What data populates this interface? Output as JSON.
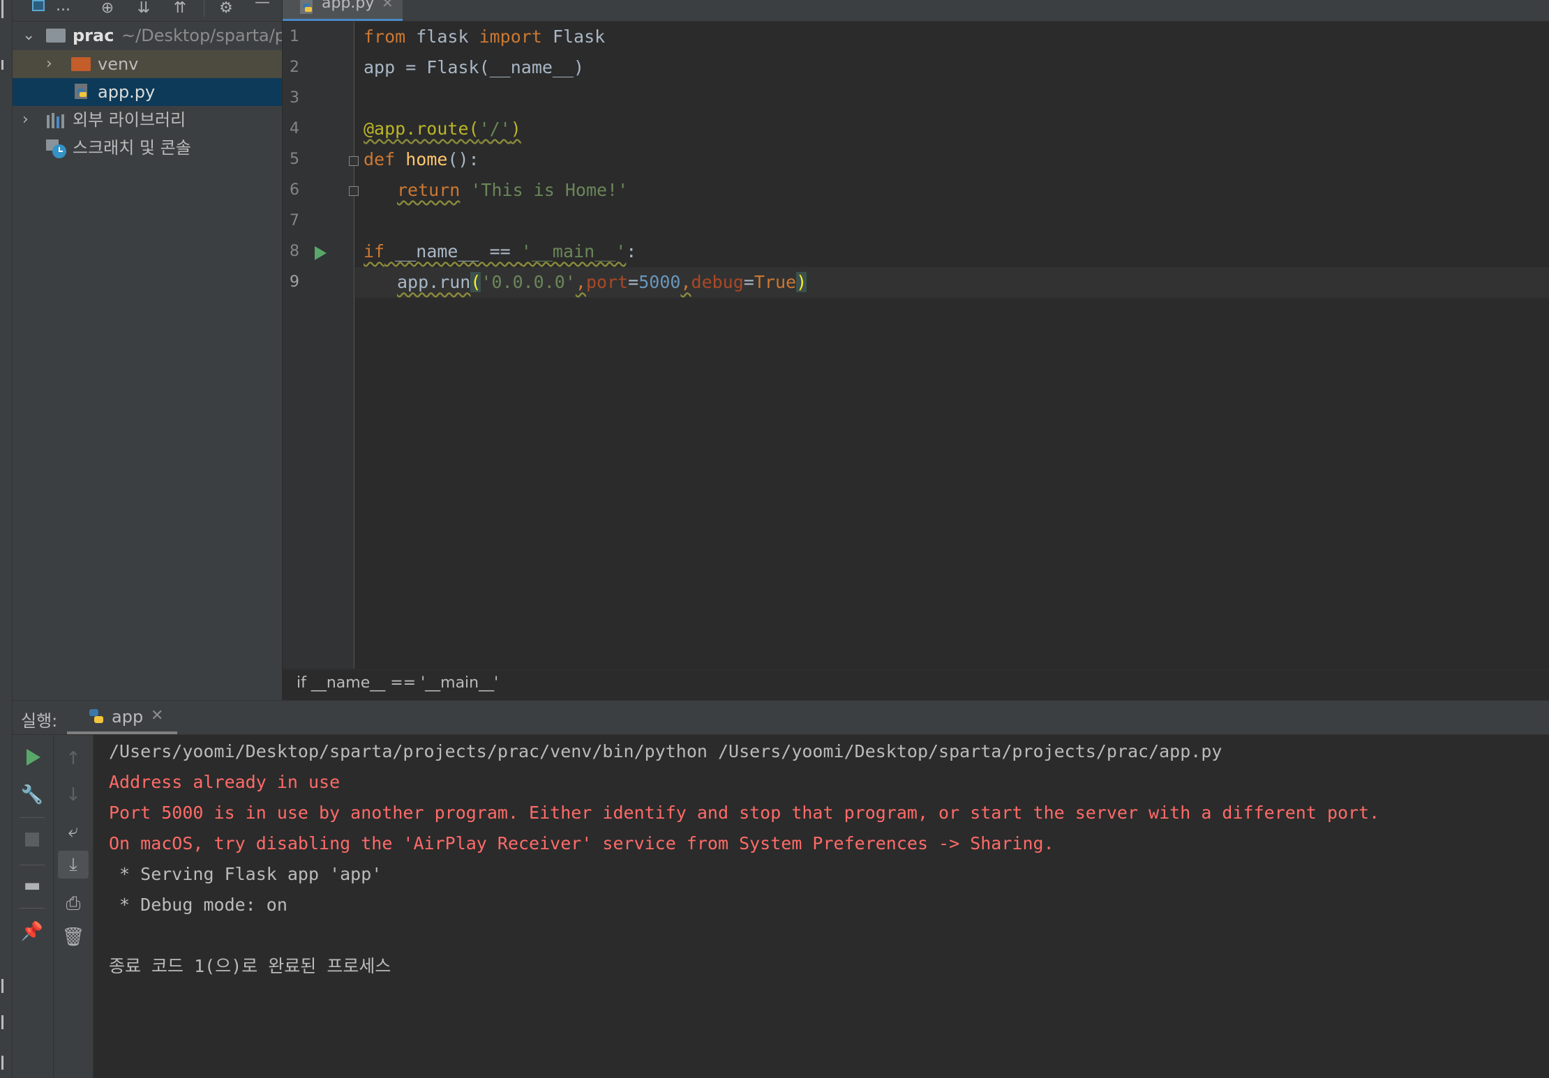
{
  "project_panel": {
    "header_dots": "...",
    "tree": [
      {
        "label": "prac",
        "path": "~/Desktop/sparta/p"
      },
      {
        "label": "venv"
      },
      {
        "label": "app.py"
      },
      {
        "label": "외부 라이브러리"
      },
      {
        "label": "스크래치 및 콘솔"
      }
    ]
  },
  "editor": {
    "tab_label": "app.py",
    "line_numbers": [
      "1",
      "2",
      "3",
      "4",
      "5",
      "6",
      "7",
      "8",
      "9"
    ],
    "breadcrumb": "if __name__ == '__main__'",
    "code": {
      "l1": [
        "from",
        " flask ",
        "import",
        " Flask"
      ],
      "l2": [
        "app = Flask(__name__)"
      ],
      "l4": [
        "@app.route(",
        "'/'",
        ")"
      ],
      "l5": [
        "def",
        " ",
        "home",
        "():"
      ],
      "l6": [
        "return",
        " ",
        "'This is Home!'"
      ],
      "l8": [
        "if",
        " __name__ == ",
        "'__main__'",
        ":"
      ],
      "l9": [
        "app.run",
        "(",
        "'0.0.0.0'",
        ",",
        "port",
        "=",
        "5000",
        ",",
        "debug",
        "=",
        "True",
        ")"
      ]
    }
  },
  "run_panel": {
    "title": "실행:",
    "tab_label": "app",
    "console": [
      "/Users/yoomi/Desktop/sparta/projects/prac/venv/bin/python /Users/yoomi/Desktop/sparta/projects/prac/app.py",
      "Address already in use",
      "Port 5000 is in use by another program. Either identify and stop that program, or start the server with a different port.",
      "On macOS, try disabling the 'AirPlay Receiver' service from System Preferences -> Sharing.",
      " * Serving Flask app 'app'",
      " * Debug mode: on",
      "종료 코드 1(으)로 완료된 프로세스"
    ]
  },
  "colors": {
    "keyword": "#cc7832",
    "string": "#6a8759",
    "number": "#6897bb",
    "function": "#ffc66d",
    "decorator": "#bbb529",
    "error_text": "#ff6b68",
    "run_green": "#59a869"
  }
}
